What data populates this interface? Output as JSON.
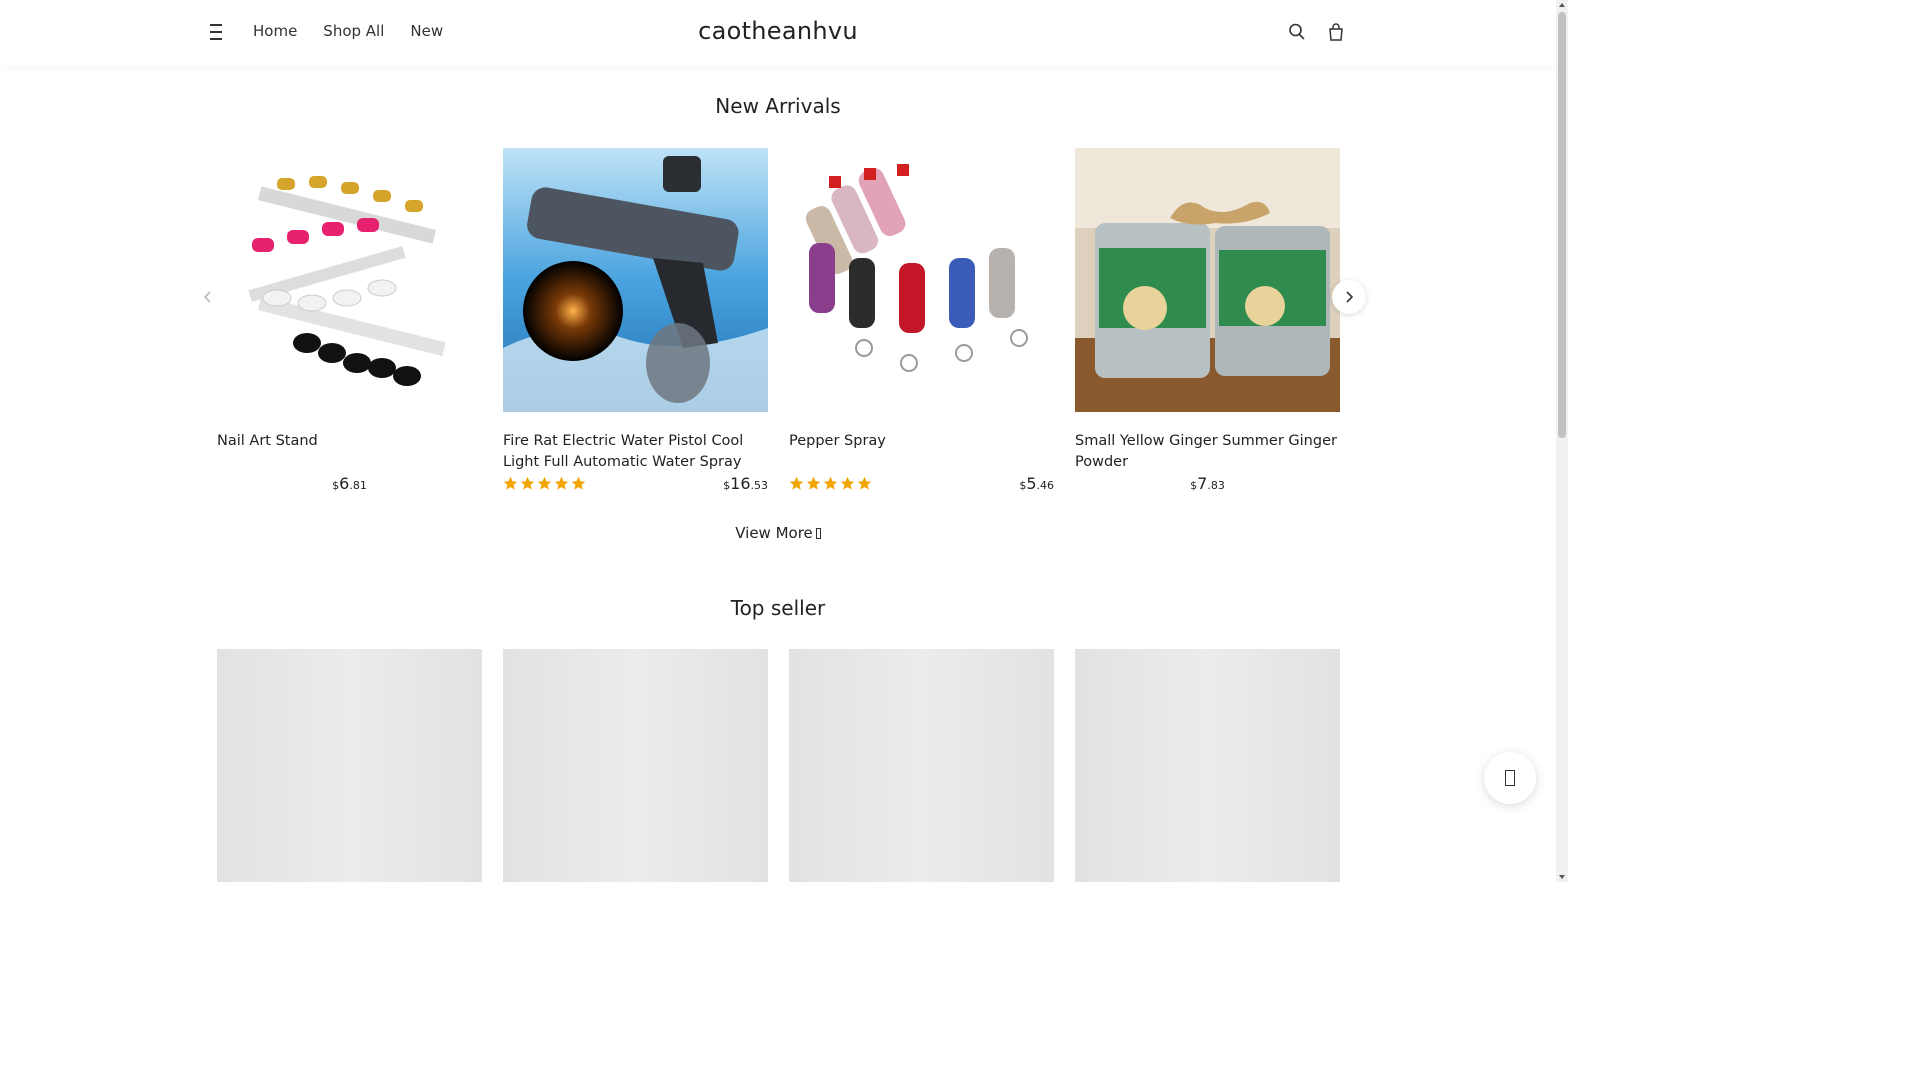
{
  "header": {
    "menu_icon": "menu-icon",
    "nav": [
      "Home",
      "Shop All",
      "New"
    ],
    "brand": "caotheanhvu",
    "search_icon": "search-icon",
    "cart_icon": "cart-icon"
  },
  "new_arrivals": {
    "title": "New Arrivals",
    "products": [
      {
        "name": "Nail Art Stand",
        "currency": "$",
        "price_int": "6",
        "price_cents": ".81",
        "rating": 0
      },
      {
        "name": "Fire Rat Electric Water Pistol Cool Light Full Automatic Water Spray Gun...",
        "currency": "$",
        "price_int": "16",
        "price_cents": ".53",
        "rating": 5
      },
      {
        "name": "Pepper Spray",
        "currency": "$",
        "price_int": "5",
        "price_cents": ".46",
        "rating": 5
      },
      {
        "name": "Small Yellow Ginger Summer Ginger Powder",
        "currency": "$",
        "price_int": "7",
        "price_cents": ".83",
        "rating": 0
      }
    ],
    "prev_icon": "chevron-left-icon",
    "next_icon": "chevron-right-icon",
    "view_more": "View More"
  },
  "top_seller": {
    "title": "Top seller"
  },
  "colors": {
    "star": "#f0a500",
    "skeleton": "#e2e2e2"
  }
}
